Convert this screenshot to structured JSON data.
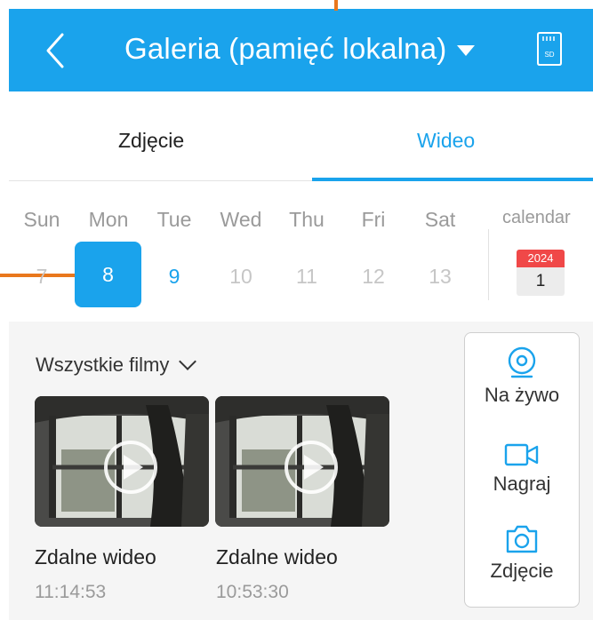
{
  "header": {
    "title": "Galeria (pamięć lokalna)",
    "sd_label": "SD"
  },
  "tabs": [
    {
      "label": "Zdjęcie"
    },
    {
      "label": "Wideo",
      "active": true
    }
  ],
  "week": {
    "days": [
      {
        "name": "Sun",
        "num": "7",
        "state": "disabled"
      },
      {
        "name": "Mon",
        "num": "8",
        "state": "selected"
      },
      {
        "name": "Tue",
        "num": "9",
        "state": "available"
      },
      {
        "name": "Wed",
        "num": "10",
        "state": "disabled"
      },
      {
        "name": "Thu",
        "num": "11",
        "state": "disabled"
      },
      {
        "name": "Fri",
        "num": "12",
        "state": "disabled"
      },
      {
        "name": "Sat",
        "num": "13",
        "state": "disabled"
      }
    ],
    "calendar_label": "calendar",
    "calendar_year": "2024",
    "calendar_day": "1"
  },
  "filter": {
    "label": "Wszystkie filmy"
  },
  "videos": [
    {
      "title": "Zdalne wideo",
      "time": "11:14:53"
    },
    {
      "title": "Zdalne wideo",
      "time": "10:53:30"
    }
  ],
  "side_panel": [
    {
      "label": "Na żywo",
      "icon": "live-camera-icon"
    },
    {
      "label": "Nagraj",
      "icon": "video-record-icon"
    },
    {
      "label": "Zdjęcie",
      "icon": "snapshot-camera-icon"
    }
  ],
  "colors": {
    "accent": "#1aa3ec",
    "annotation": "#e9781d",
    "calendar_red": "#f04848"
  }
}
